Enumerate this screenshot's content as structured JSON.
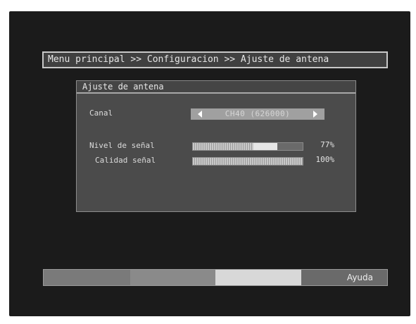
{
  "breadcrumb": {
    "text": "Menu principal >> Configuracion >> Ajuste de antena"
  },
  "panel": {
    "title": "Ajuste de antena",
    "channel": {
      "label": "Canal",
      "value": "CH40 (626000)"
    },
    "signal_level": {
      "label": "Nivel de señal",
      "value_text": "77%",
      "level_percent": 77
    },
    "signal_quality": {
      "label": "Calidad señal",
      "value_text": "100%",
      "level_percent": 100
    }
  },
  "bottom_bar": {
    "segments": [
      {
        "color": "#7a7a7a",
        "label": ""
      },
      {
        "color": "#8a8a8a",
        "label": ""
      },
      {
        "color": "#d8d8d8",
        "label": ""
      },
      {
        "color": "#6a6a6a",
        "label": "Ayuda"
      }
    ]
  },
  "icons": {
    "left": "arrow-left-icon",
    "right": "arrow-right-icon"
  }
}
